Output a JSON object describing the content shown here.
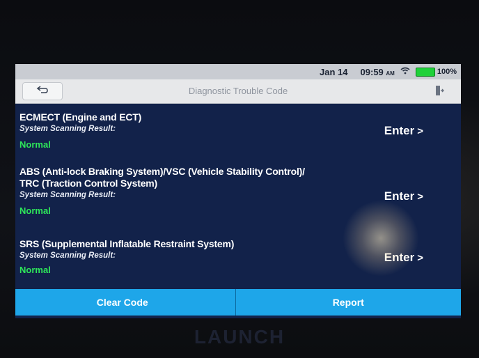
{
  "status_bar": {
    "date": "Jan 14",
    "time": "09:59",
    "ampm": "AM",
    "battery": "100%"
  },
  "header": {
    "title": "Diagnostic Trouble Code",
    "back_icon": "back-arrow-icon",
    "exit_icon": "exit-icon"
  },
  "systems": [
    {
      "name_lines": [
        "ECMECT (Engine and ECT)"
      ],
      "scan_label": "System Scanning Result:",
      "status": "Normal",
      "enter_label": "Enter",
      "enter_chevron": ">"
    },
    {
      "name_lines": [
        "ABS (Anti-lock Braking System)/VSC (Vehicle Stability Control)/",
        "TRC (Traction Control System)"
      ],
      "scan_label": "System Scanning Result:",
      "status": "Normal",
      "enter_label": "Enter",
      "enter_chevron": ">"
    },
    {
      "name_lines": [
        "SRS (Supplemental Inflatable Restraint System)"
      ],
      "scan_label": "System Scanning Result:",
      "status": "Normal",
      "enter_label": "Enter",
      "enter_chevron": ">"
    }
  ],
  "footer": {
    "clear_code": "Clear Code",
    "report": "Report"
  },
  "brand": "LAUNCH",
  "colors": {
    "screen_bg": "#12224a",
    "status_normal": "#2ee65a",
    "footer_bg": "#1ea6e9"
  }
}
